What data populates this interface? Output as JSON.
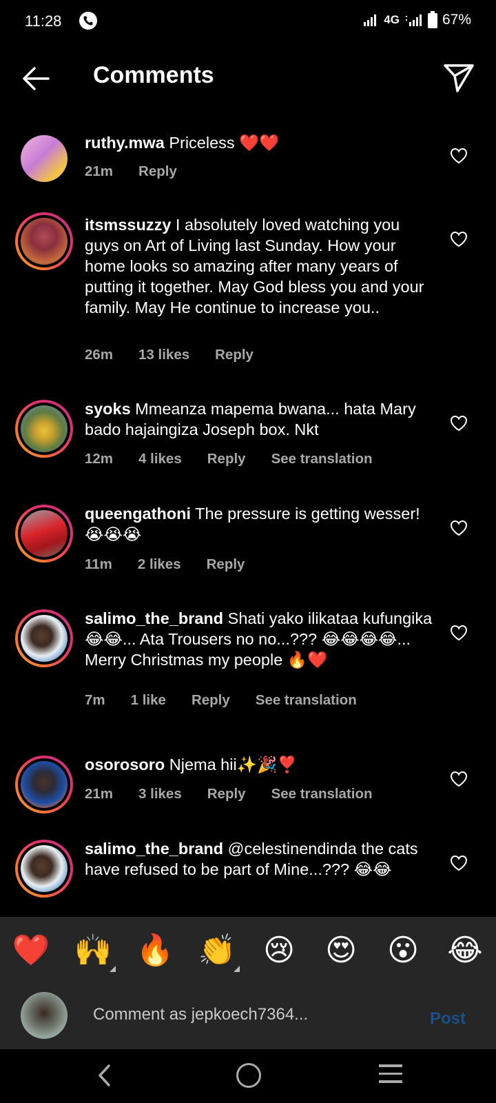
{
  "status_bar": {
    "time": "11:28",
    "network": "4G",
    "battery": "67%"
  },
  "header": {
    "title": "Comments"
  },
  "comments": [
    {
      "username": "ruthy.mwa",
      "text": "Priceless ❤️❤️",
      "time": "21m",
      "likes": "",
      "reply": "Reply",
      "translate": ""
    },
    {
      "username": "itsmssuzzy",
      "text": "I absolutely loved watching you guys on Art of Living last Sunday. How your home looks so amazing after many years of putting it together. May God bless you and your family. May He continue to increase you..",
      "time": "26m",
      "likes": "13 likes",
      "reply": "Reply",
      "translate": ""
    },
    {
      "username": "syoks",
      "text": "Mmeanza mapema bwana... hata Mary bado hajaingiza Joseph box. Nkt",
      "time": "12m",
      "likes": "4 likes",
      "reply": "Reply",
      "translate": "See translation"
    },
    {
      "username": "queengathoni",
      "text": "The pressure is getting wesser! 😭😭😭",
      "time": "11m",
      "likes": "2 likes",
      "reply": "Reply",
      "translate": ""
    },
    {
      "username": "salimo_the_brand",
      "text": "Shati yako ilikataa kufungika😂😂... Ata Trousers no no...??? 😂😂😂😂... Merry Christmas my people 🔥❤️",
      "time": "7m",
      "likes": "1 like",
      "reply": "Reply",
      "translate": "See translation"
    },
    {
      "username": "osorosoro",
      "text": "Njema hii✨🎉❣️",
      "time": "21m",
      "likes": "3 likes",
      "reply": "Reply",
      "translate": "See translation"
    },
    {
      "username": "salimo_the_brand",
      "text": "@celestinendinda the cats have refused to be part of Mine...??? 😂😂",
      "time": "",
      "likes": "",
      "reply": "",
      "translate": ""
    }
  ],
  "quick_reactions": [
    "❤️",
    "🙌",
    "🔥",
    "👏",
    "😢",
    "😍",
    "😮",
    "😂"
  ],
  "compose": {
    "placeholder": "Comment as jepkoech7364...",
    "post_label": "Post"
  },
  "colors": {
    "background": "#000000",
    "muted_text": "#a8a8a8",
    "panel": "#262626",
    "post_disabled": "#1b4f87"
  }
}
